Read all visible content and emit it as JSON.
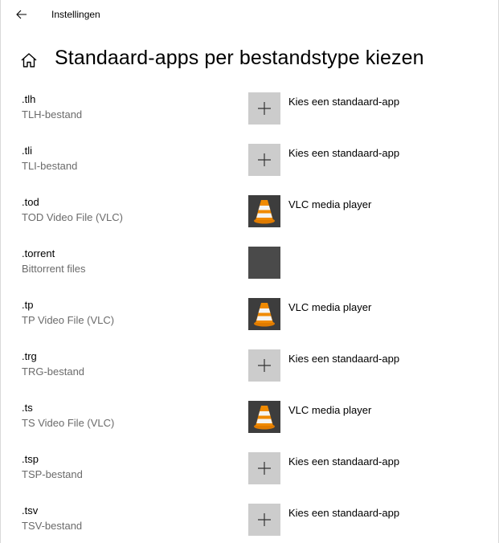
{
  "window": {
    "app_title": "Instellingen"
  },
  "page": {
    "title": "Standaard-apps per bestandstype kiezen"
  },
  "rows": [
    {
      "ext": ".tlh",
      "desc": "TLH-bestand",
      "app": "Kies een standaard-app",
      "icon": "plus-icon"
    },
    {
      "ext": ".tli",
      "desc": "TLI-bestand",
      "app": "Kies een standaard-app",
      "icon": "plus-icon"
    },
    {
      "ext": ".tod",
      "desc": "TOD Video File (VLC)",
      "app": "VLC media player",
      "icon": "vlc-icon"
    },
    {
      "ext": ".torrent",
      "desc": "Bittorrent files",
      "app": "",
      "icon": "blank-app-icon"
    },
    {
      "ext": ".tp",
      "desc": "TP Video File (VLC)",
      "app": "VLC media player",
      "icon": "vlc-icon"
    },
    {
      "ext": ".trg",
      "desc": "TRG-bestand",
      "app": "Kies een standaard-app",
      "icon": "plus-icon"
    },
    {
      "ext": ".ts",
      "desc": "TS Video File (VLC)",
      "app": "VLC media player",
      "icon": "vlc-icon"
    },
    {
      "ext": ".tsp",
      "desc": "TSP-bestand",
      "app": "Kies een standaard-app",
      "icon": "plus-icon"
    },
    {
      "ext": ".tsv",
      "desc": "TSV-bestand",
      "app": "Kies een standaard-app",
      "icon": "plus-icon"
    }
  ],
  "colors": {
    "plus_tile": "#cccccc",
    "vlc_tile": "#3d3d3d",
    "vlc_orange": "#f08a00",
    "secondary_text": "#6b6b6b"
  }
}
